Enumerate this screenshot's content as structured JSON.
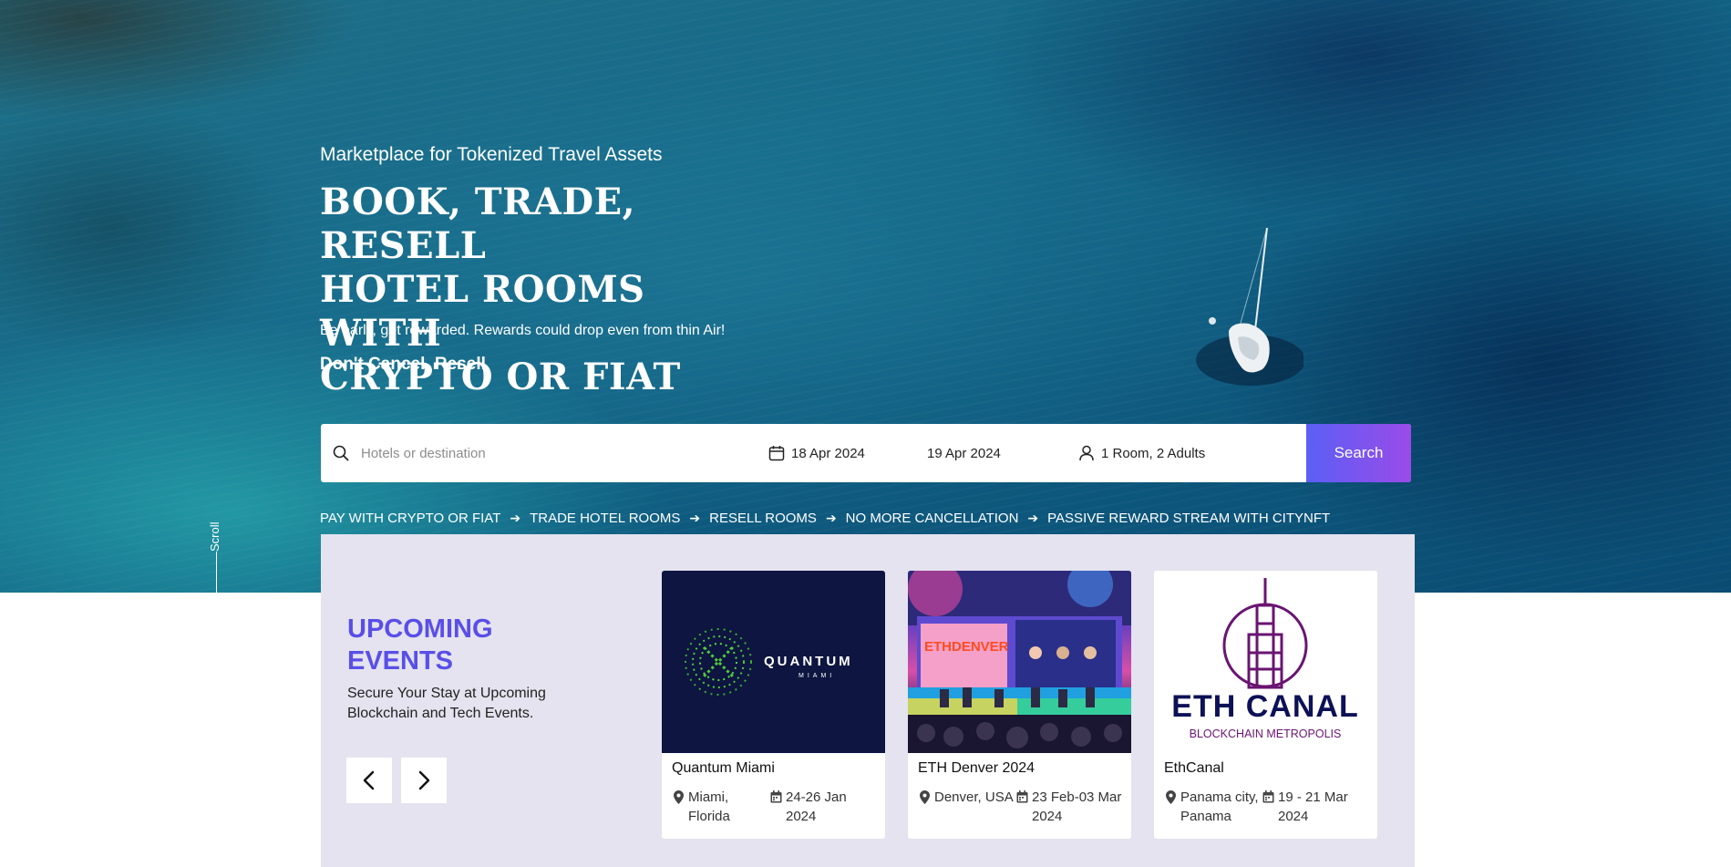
{
  "hero": {
    "subtitle": "Marketplace for Tokenized Travel Assets",
    "headline_line1": "BOOK, TRADE, RESELL",
    "headline_line2": "HOTEL ROOMS WITH",
    "headline_line3": "CRYPTO OR FIAT",
    "tagline": "Be early, get rewarded. Rewards could drop even from thin Air!",
    "resell": "Don't Cancel, Resell"
  },
  "search": {
    "destination_placeholder": "Hotels or destination",
    "checkin": "18 Apr 2024",
    "checkout": "19 Apr 2024",
    "guests": "1 Room, 2 Adults",
    "button": "Search"
  },
  "features": [
    "PAY WITH CRYPTO OR FIAT",
    "TRADE HOTEL ROOMS",
    "RESELL ROOMS",
    "NO MORE CANCELLATION",
    "PASSIVE REWARD STREAM WITH CITYNFT"
  ],
  "scroll_label": "Scroll",
  "events": {
    "title_line1": "UPCOMING",
    "title_line2": "EVENTS",
    "description": "Secure Your Stay at Upcoming Blockchain and Tech Events.",
    "cards": [
      {
        "name": "Quantum Miami",
        "location": "Miami, Florida",
        "dates": "24-26 Jan 2024",
        "logo_text": "QUANTUM",
        "logo_sub": "MIAMI"
      },
      {
        "name": "ETH Denver 2024",
        "location": "Denver, USA",
        "dates": "23 Feb-03 Mar 2024",
        "logo_text": "ETHDENVER"
      },
      {
        "name": "EthCanal",
        "location": "Panama city, Panama",
        "dates": "19 - 21 Mar 2024",
        "logo_text": "ETH CANAL",
        "logo_sub": "BLOCKCHAIN METROPOLIS"
      }
    ]
  },
  "colors": {
    "accent": "#5a4ee8",
    "button_gradient_start": "#5b5ff5",
    "button_gradient_end": "#9a4be8",
    "panel_bg": "#e4e3ef"
  }
}
